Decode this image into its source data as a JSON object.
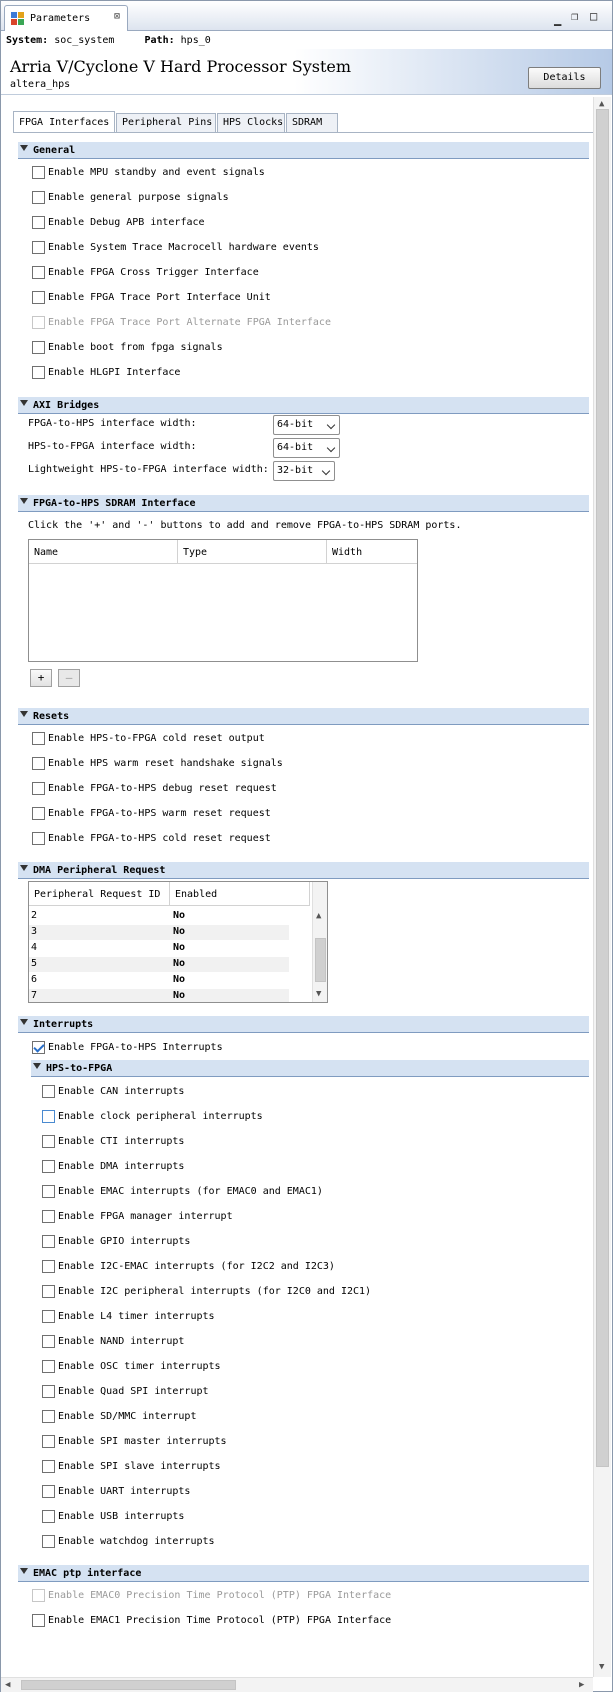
{
  "window": {
    "tab_title": "Parameters",
    "close_glyph": "⊠",
    "min_glyph": "▁",
    "restore_glyph": "❐",
    "max_glyph": "□"
  },
  "infobar": {
    "system_label": "System:",
    "system_value": "soc_system",
    "path_label": "Path:",
    "path_value": "hps_0"
  },
  "header": {
    "title": "Arria V/Cyclone V Hard Processor System",
    "subtitle": "altera_hps",
    "details_button": "Details"
  },
  "tabs": [
    {
      "label": "FPGA Interfaces",
      "active": true
    },
    {
      "label": "Peripheral Pins",
      "active": false
    },
    {
      "label": "HPS Clocks",
      "active": false
    },
    {
      "label": "SDRAM",
      "active": false
    }
  ],
  "general": {
    "title": "General",
    "items": [
      {
        "label": "Enable MPU standby and event signals",
        "checked": false,
        "disabled": false
      },
      {
        "label": "Enable general purpose signals",
        "checked": false,
        "disabled": false
      },
      {
        "label": "Enable Debug APB interface",
        "checked": false,
        "disabled": false
      },
      {
        "label": "Enable System Trace Macrocell hardware events",
        "checked": false,
        "disabled": false
      },
      {
        "label": "Enable FPGA Cross Trigger Interface",
        "checked": false,
        "disabled": false
      },
      {
        "label": "Enable FPGA Trace Port Interface Unit",
        "checked": false,
        "disabled": false
      },
      {
        "label": "Enable FPGA Trace Port Alternate FPGA Interface",
        "checked": false,
        "disabled": true
      },
      {
        "label": "Enable boot from fpga signals",
        "checked": false,
        "disabled": false
      },
      {
        "label": "Enable HLGPI Interface",
        "checked": false,
        "disabled": false
      }
    ]
  },
  "axi": {
    "title": "AXI Bridges",
    "rows": [
      {
        "label": "FPGA-to-HPS interface width:",
        "value": "64-bit"
      },
      {
        "label": "HPS-to-FPGA interface width:",
        "value": "64-bit"
      },
      {
        "label": "Lightweight HPS-to-FPGA interface width:",
        "value": "32-bit"
      }
    ]
  },
  "sdram": {
    "title": "FPGA-to-HPS SDRAM Interface",
    "description": "Click the '+' and '-' buttons to add and remove FPGA-to-HPS SDRAM ports.",
    "columns": [
      "Name",
      "Type",
      "Width"
    ],
    "add_label": "+",
    "remove_label": "—"
  },
  "resets": {
    "title": "Resets",
    "items": [
      {
        "label": "Enable HPS-to-FPGA cold reset output",
        "checked": false
      },
      {
        "label": "Enable HPS warm reset handshake signals",
        "checked": false
      },
      {
        "label": "Enable FPGA-to-HPS debug reset request",
        "checked": false
      },
      {
        "label": "Enable FPGA-to-HPS warm reset request",
        "checked": false
      },
      {
        "label": "Enable FPGA-to-HPS cold reset request",
        "checked": false
      }
    ]
  },
  "dma": {
    "title": "DMA Peripheral Request",
    "columns": [
      "Peripheral Request ID",
      "Enabled"
    ],
    "rows": [
      {
        "id": "2",
        "enabled": "No"
      },
      {
        "id": "3",
        "enabled": "No"
      },
      {
        "id": "4",
        "enabled": "No"
      },
      {
        "id": "5",
        "enabled": "No"
      },
      {
        "id": "6",
        "enabled": "No"
      },
      {
        "id": "7",
        "enabled": "No"
      }
    ]
  },
  "interrupts": {
    "title": "Interrupts",
    "enable_label": "Enable FPGA-to-HPS Interrupts",
    "enable_checked": true,
    "subsection_title": "HPS-to-FPGA",
    "items": [
      {
        "label": "Enable CAN interrupts",
        "checked": false
      },
      {
        "label": "Enable clock peripheral interrupts",
        "checked": false
      },
      {
        "label": "Enable CTI interrupts",
        "checked": false
      },
      {
        "label": "Enable DMA interrupts",
        "checked": false
      },
      {
        "label": "Enable EMAC interrupts (for EMAC0 and EMAC1)",
        "checked": false
      },
      {
        "label": "Enable FPGA manager interrupt",
        "checked": false
      },
      {
        "label": "Enable GPIO interrupts",
        "checked": false
      },
      {
        "label": "Enable I2C-EMAC interrupts (for I2C2 and I2C3)",
        "checked": false
      },
      {
        "label": "Enable I2C peripheral interrupts (for I2C0 and I2C1)",
        "checked": false
      },
      {
        "label": "Enable L4 timer interrupts",
        "checked": false
      },
      {
        "label": "Enable NAND interrupt",
        "checked": false
      },
      {
        "label": "Enable OSC timer interrupts",
        "checked": false
      },
      {
        "label": "Enable Quad SPI interrupt",
        "checked": false
      },
      {
        "label": "Enable SD/MMC interrupt",
        "checked": false
      },
      {
        "label": "Enable SPI master interrupts",
        "checked": false
      },
      {
        "label": "Enable SPI slave interrupts",
        "checked": false
      },
      {
        "label": "Enable UART interrupts",
        "checked": false
      },
      {
        "label": "Enable USB interrupts",
        "checked": false
      },
      {
        "label": "Enable watchdog interrupts",
        "checked": false
      }
    ]
  },
  "emac": {
    "title": "EMAC ptp interface",
    "items": [
      {
        "label": "Enable EMAC0 Precision Time Protocol (PTP) FPGA Interface",
        "checked": false,
        "disabled": true
      },
      {
        "label": "Enable EMAC1 Precision Time Protocol (PTP) FPGA Interface",
        "checked": false,
        "disabled": false
      }
    ]
  },
  "scroll": {
    "up_arrow": "▲",
    "down_arrow": "▼",
    "left_arrow": "◀",
    "right_arrow": "▶"
  }
}
